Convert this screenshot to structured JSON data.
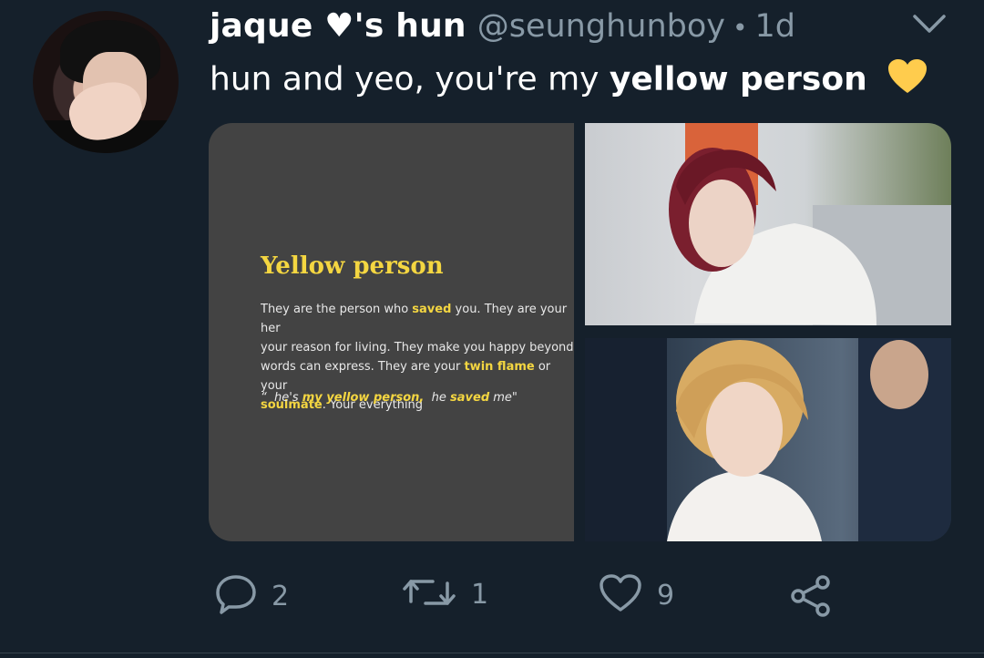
{
  "tweet": {
    "display_name": "jaque ♥'s hun",
    "handle": "@seunghunboy",
    "separator": "•",
    "time": "1d",
    "text_prefix": "hun and yeo, you're my",
    "text_bold": "yellow person",
    "emoji": "yellow-heart-emoji"
  },
  "card": {
    "title": "Yellow person",
    "body_1": "They are the person who",
    "saved": "saved",
    "body_2": "you. They are your her\nyour reason for living. They make you happy beyond\nwords can express. They are your",
    "twin_flame": "twin flame",
    "body_3": "or your",
    "soulmate": "soulmate",
    "body_4": ". Your everything",
    "quote_open": "“  he's",
    "quote_yellow": "my yellow person,",
    "quote_mid": "he",
    "quote_saved": "saved",
    "quote_end": "me\""
  },
  "actions": {
    "reply_count": "2",
    "retweet_count": "1",
    "like_count": "9"
  },
  "colors": {
    "background": "#15202b",
    "muted": "#8899a6",
    "highlight_yellow": "#f4d641",
    "heart_yellow": "#ffcc4d"
  }
}
